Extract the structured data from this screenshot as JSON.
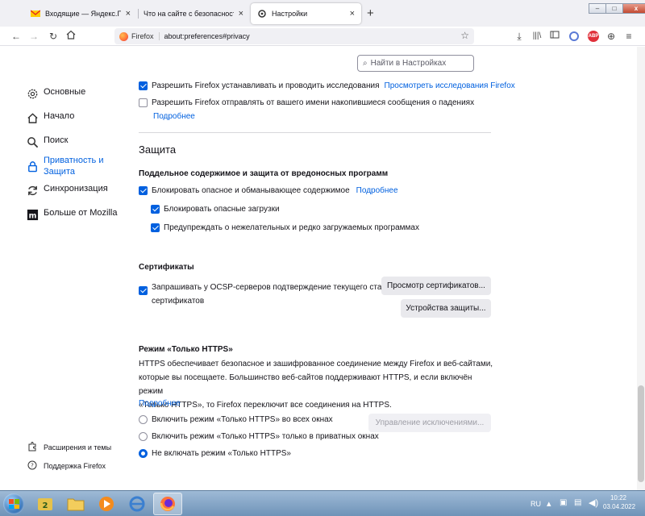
{
  "tabs": [
    {
      "title": "Входящие — Яндекс.Почта",
      "close": "×"
    },
    {
      "title": "Что на сайте с безопасностью? - С",
      "close": "×"
    },
    {
      "title": "Настройки",
      "close": "×"
    }
  ],
  "new_tab": "+",
  "window_controls": {
    "minimize": "–",
    "maximize": "□",
    "close": "x"
  },
  "urlbar": {
    "brand": "Firefox",
    "url": "about:preferences#privacy"
  },
  "search": {
    "placeholder": "Найти в Настройках"
  },
  "sidebar": {
    "items": [
      {
        "label": "Основные",
        "icon": "gear-icon"
      },
      {
        "label": "Начало",
        "icon": "home-icon"
      },
      {
        "label": "Поиск",
        "icon": "search-icon"
      },
      {
        "label": "Приватность и Защита",
        "icon": "lock-icon",
        "selected": true
      },
      {
        "label": "Синхронизация",
        "icon": "sync-icon"
      },
      {
        "label": "Больше от Mozilla",
        "icon": "mozilla-icon"
      }
    ],
    "footer": [
      {
        "label": "Расширения и темы",
        "icon": "puzzle-icon"
      },
      {
        "label": "Поддержка Firefox",
        "icon": "help-icon"
      }
    ]
  },
  "data_collection": {
    "studies_label": "Разрешить Firefox устанавливать и проводить исследования",
    "studies_link": "Просмотреть исследования Firefox",
    "crash_label": "Разрешить Firefox отправлять от вашего имени накопившиеся сообщения о падениях",
    "crash_link": "Подробнее"
  },
  "protection": {
    "heading": "Защита",
    "deceptive_heading": "Поддельное содержимое и защита от вредоносных программ",
    "block_dangerous": "Блокировать опасное и обманывающее содержимое",
    "block_dangerous_link": "Подробнее",
    "block_downloads": "Блокировать опасные загрузки",
    "warn_unwanted": "Предупреждать о нежелательных и редко загружаемых программах"
  },
  "certificates": {
    "heading": "Сертификаты",
    "ocsp_line1": "Запрашивать у OCSP-серверов подтверждение текущего статуса",
    "ocsp_line2": "сертификатов",
    "view_button": "Просмотр сертификатов...",
    "devices_button": "Устройства защиты..."
  },
  "https_only": {
    "heading": "Режим «Только HTTPS»",
    "desc_line1": "HTTPS обеспечивает безопасное и зашифрованное соединение между Firefox и веб-сайтами,",
    "desc_line2": "которые вы посещаете. Большинство веб-сайтов поддерживают HTTPS, и если включён режим",
    "desc_line3": "«Только HTTPS», то Firefox переключит все соединения на HTTPS.",
    "learn_more": "Подробнее",
    "opt_all": "Включить режим «Только HTTPS» во всех окнах",
    "opt_private": "Включить режим «Только HTTPS» только в приватных окнах",
    "opt_off": "Не включать режим «Только HTTPS»",
    "selected": "opt_off",
    "exceptions_button": "Управление исключениями..."
  },
  "taskbar": {
    "lang": "RU",
    "time": "10:22",
    "date": "03.04.2022"
  },
  "colors": {
    "accent": "#0060df",
    "taskbar": "#7fa1c4"
  }
}
